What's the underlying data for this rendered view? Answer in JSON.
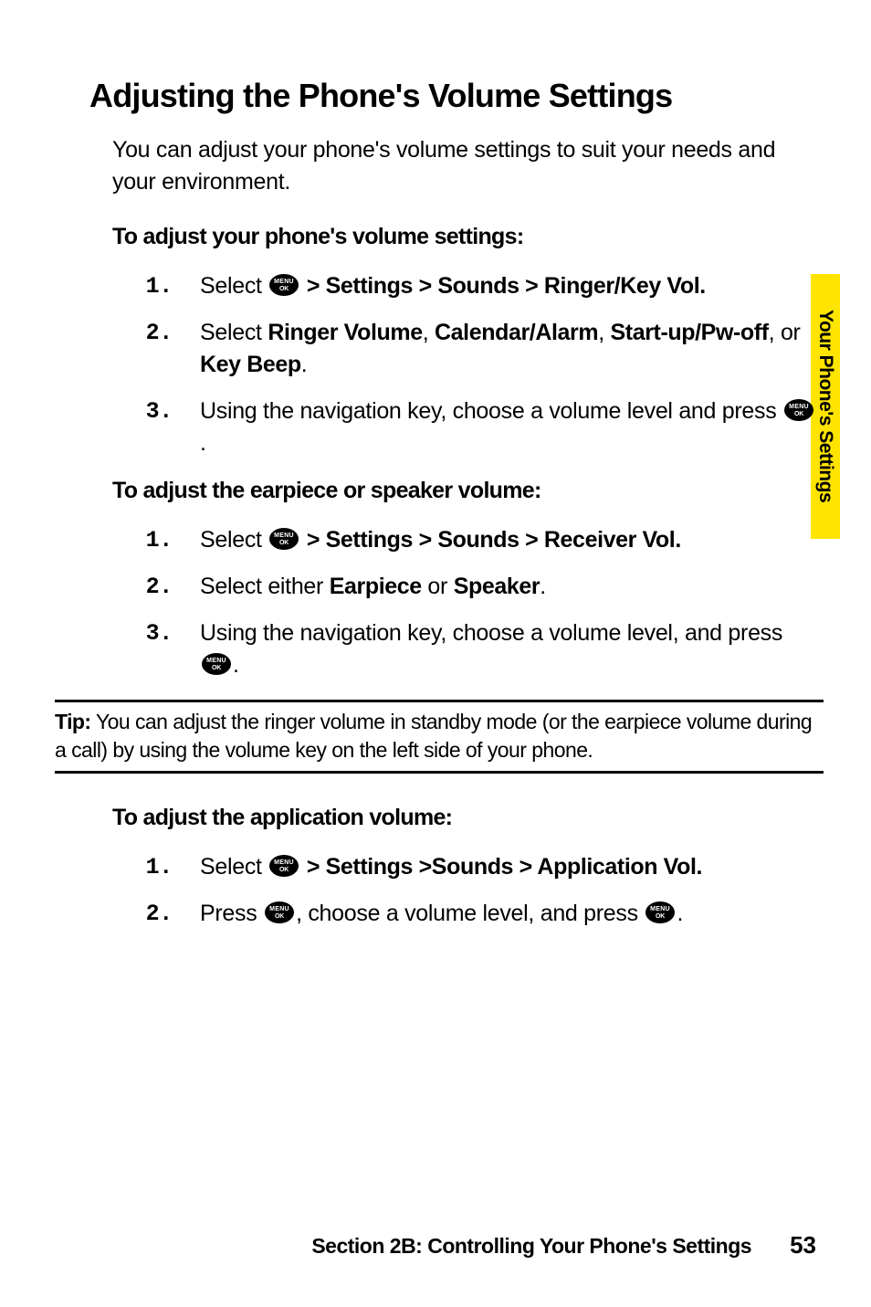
{
  "sideTab": "Your Phone's Settings",
  "heading": "Adjusting the Phone's Volume Settings",
  "intro": "You can adjust your phone's volume settings to suit your needs and your environment.",
  "sub1": "To adjust your phone's volume settings:",
  "s1": {
    "a_pre": "Select ",
    "a_bold": " > Settings > Sounds > Ringer/Key Vol.",
    "b_pre": "Select ",
    "b_b1": "Ringer Volume",
    "b_mid1": ", ",
    "b_b2": "Calendar/Alarm",
    "b_mid2": ", ",
    "b_b3": "Start-up/Pw-off",
    "b_mid3": ", or ",
    "b_b4": "Key Beep",
    "b_end": ".",
    "c_pre": "Using the navigation key, choose a volume level and press ",
    "c_end": "."
  },
  "sub2": "To adjust the earpiece or speaker volume:",
  "s2": {
    "a_pre": "Select ",
    "a_bold": " > Settings > Sounds > Receiver Vol.",
    "b_pre": "Select either ",
    "b_b1": "Earpiece",
    "b_mid": " or ",
    "b_b2": "Speaker",
    "b_end": ".",
    "c_pre": "Using the navigation key, choose a volume level, and press ",
    "c_end": "."
  },
  "tip": {
    "label": "Tip:",
    "text": " You can adjust the ringer volume in standby mode (or the earpiece volume during a call) by using the volume key on the left side of your phone."
  },
  "sub3": "To adjust the application volume:",
  "s3": {
    "a_pre": "Select ",
    "a_bold": " > Settings >Sounds > Application Vol.",
    "b_pre": "Press ",
    "b_mid": ", choose a volume level, and press ",
    "b_end": "."
  },
  "footer": {
    "section": "Section 2B: Controlling Your Phone's Settings",
    "page": "53"
  }
}
